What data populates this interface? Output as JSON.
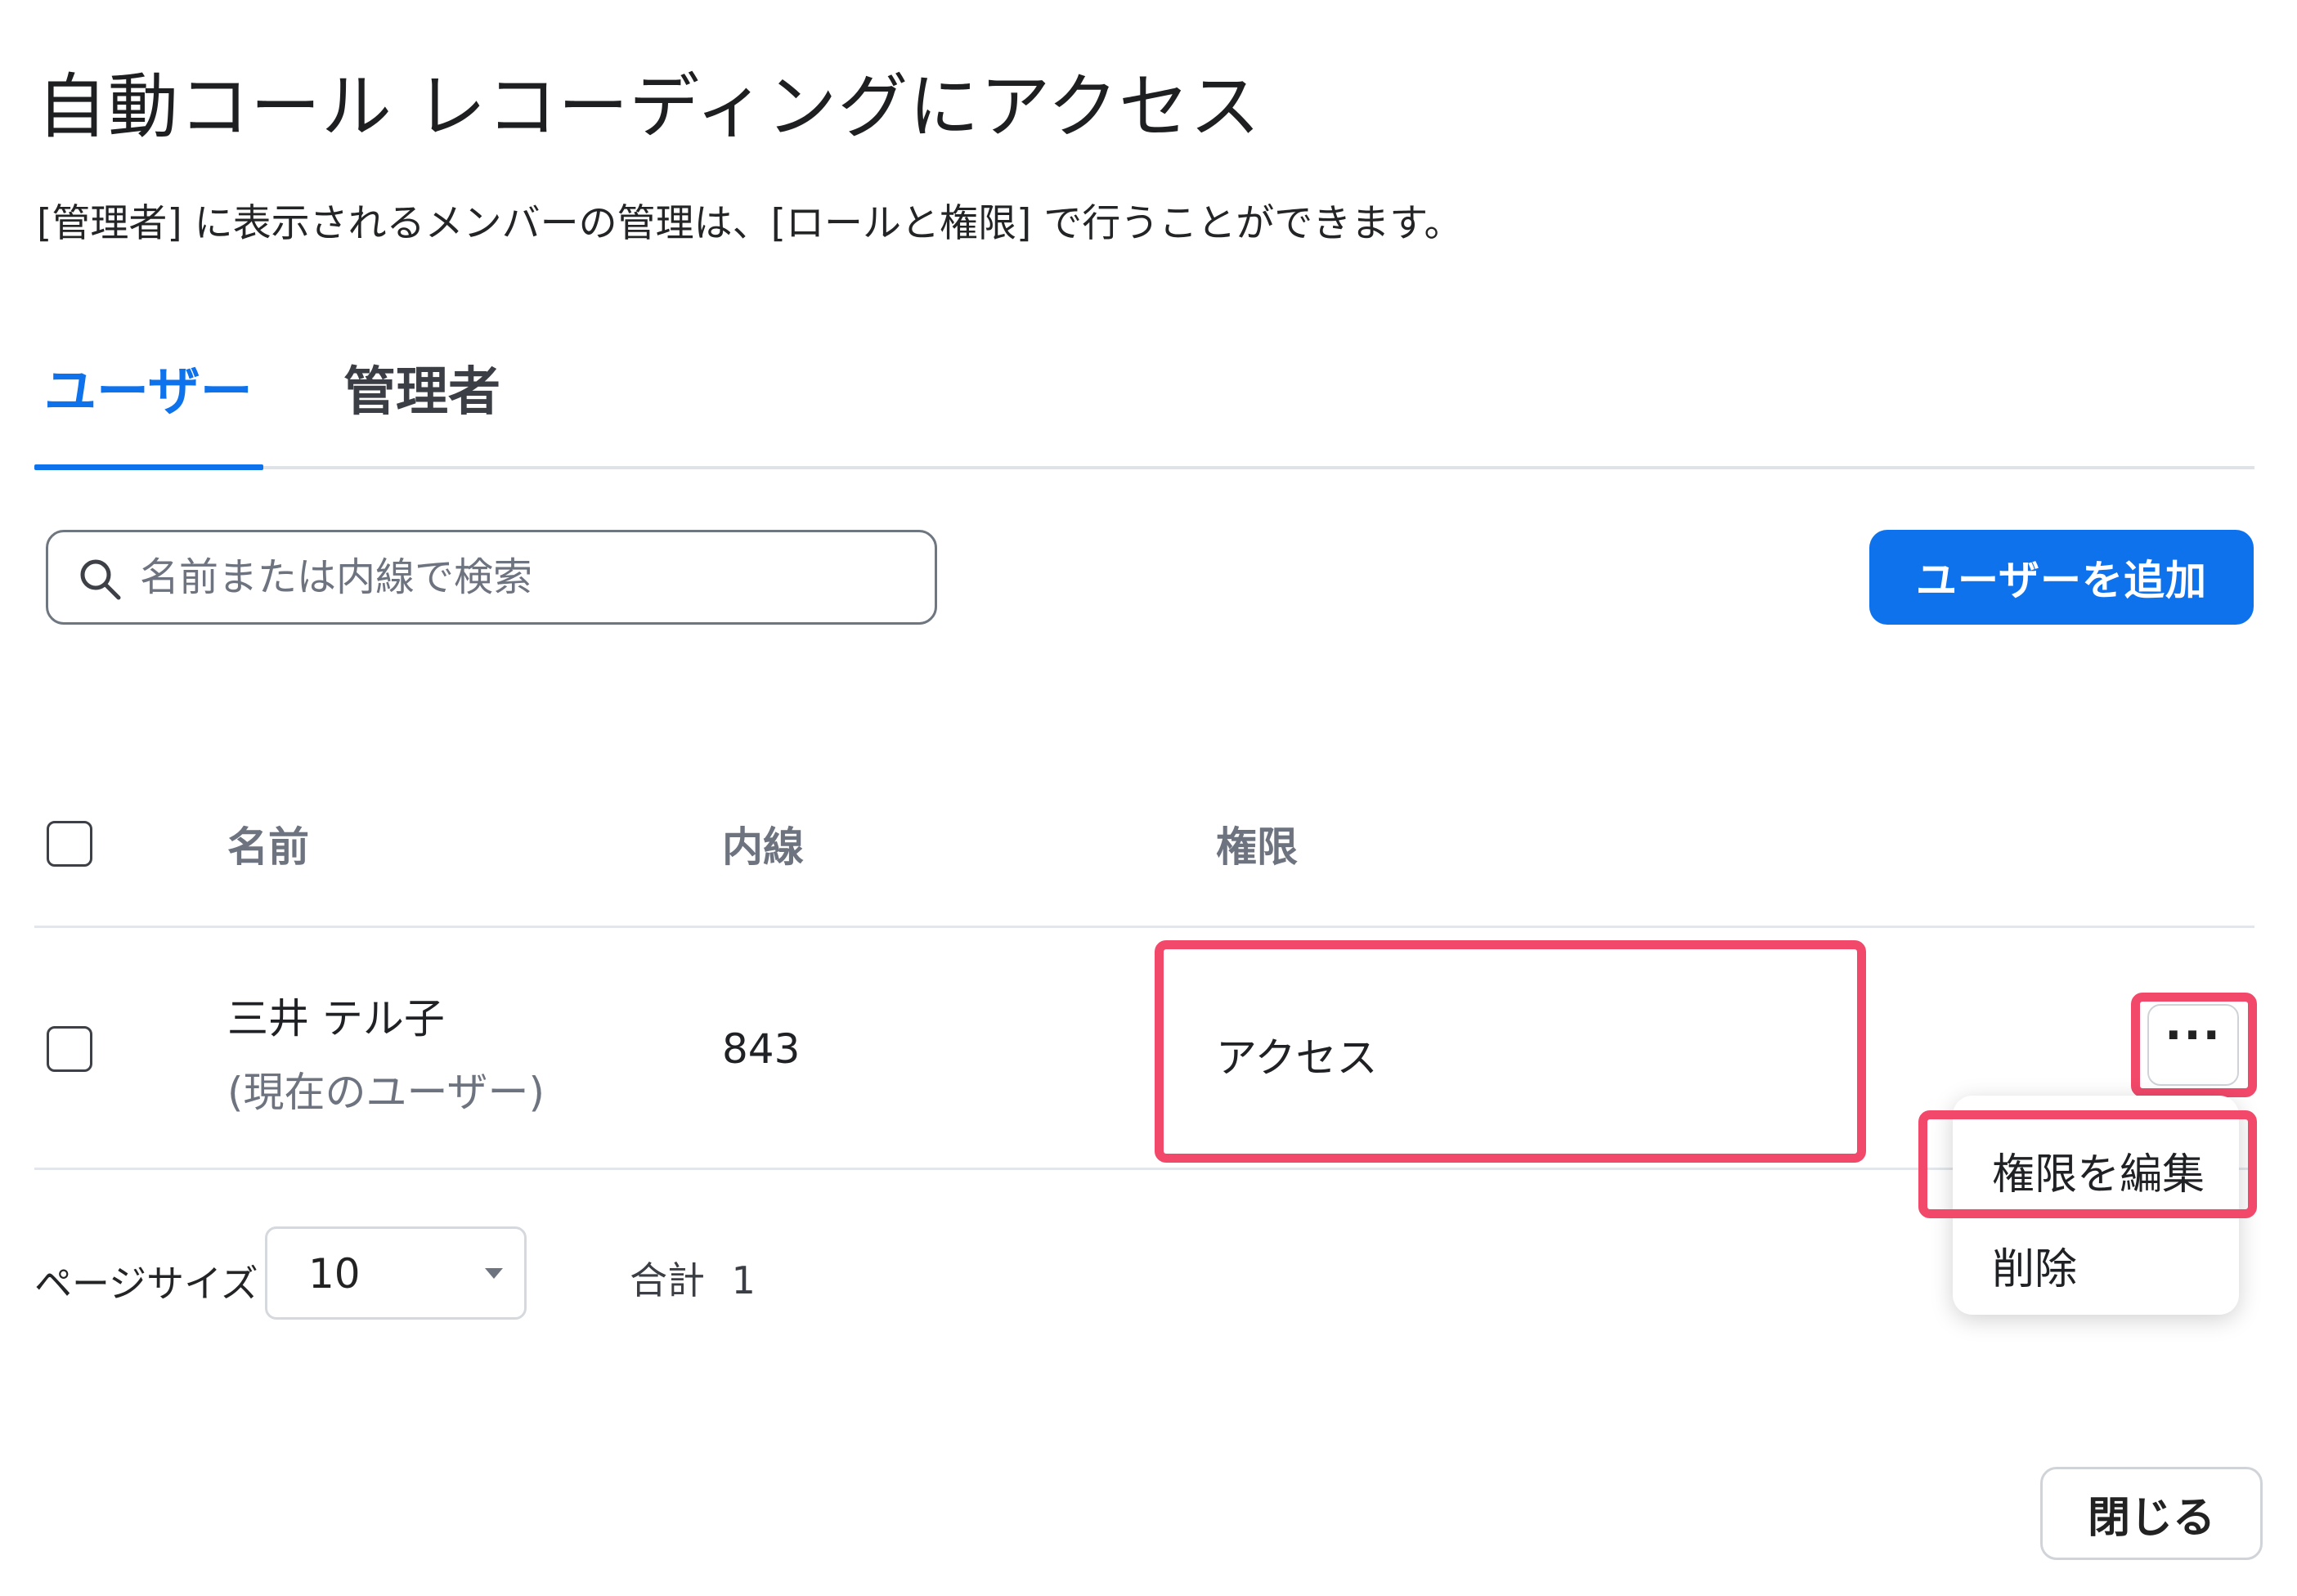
{
  "dialog": {
    "title": "自動コール レコーディングにアクセス",
    "description": "[管理者] に表示されるメンバーの管理は、[ロールと権限] で行うことができます。"
  },
  "tabs": [
    {
      "label": "ユーザー",
      "active": true
    },
    {
      "label": "管理者",
      "active": false
    }
  ],
  "search": {
    "placeholder": "名前または内線で検索",
    "icon": "search-icon"
  },
  "toolbar": {
    "add_user_label": "ユーザーを追加"
  },
  "table": {
    "columns": [
      "名前",
      "内線",
      "権限"
    ],
    "rows": [
      {
        "name": "三井 テル子",
        "note": "(現在のユーザー)",
        "extension": "843",
        "permission": "アクセス"
      }
    ]
  },
  "row_menu": {
    "trigger_label": "···",
    "items": [
      "権限を編集",
      "削除"
    ]
  },
  "pagination": {
    "page_size_label": "ページサイズ",
    "page_size": "10",
    "total_label": "合計",
    "total": "1"
  },
  "footer": {
    "close_label": "閉じる"
  },
  "colors": {
    "accent": "#0e72ed",
    "highlight": "#f2486a"
  }
}
